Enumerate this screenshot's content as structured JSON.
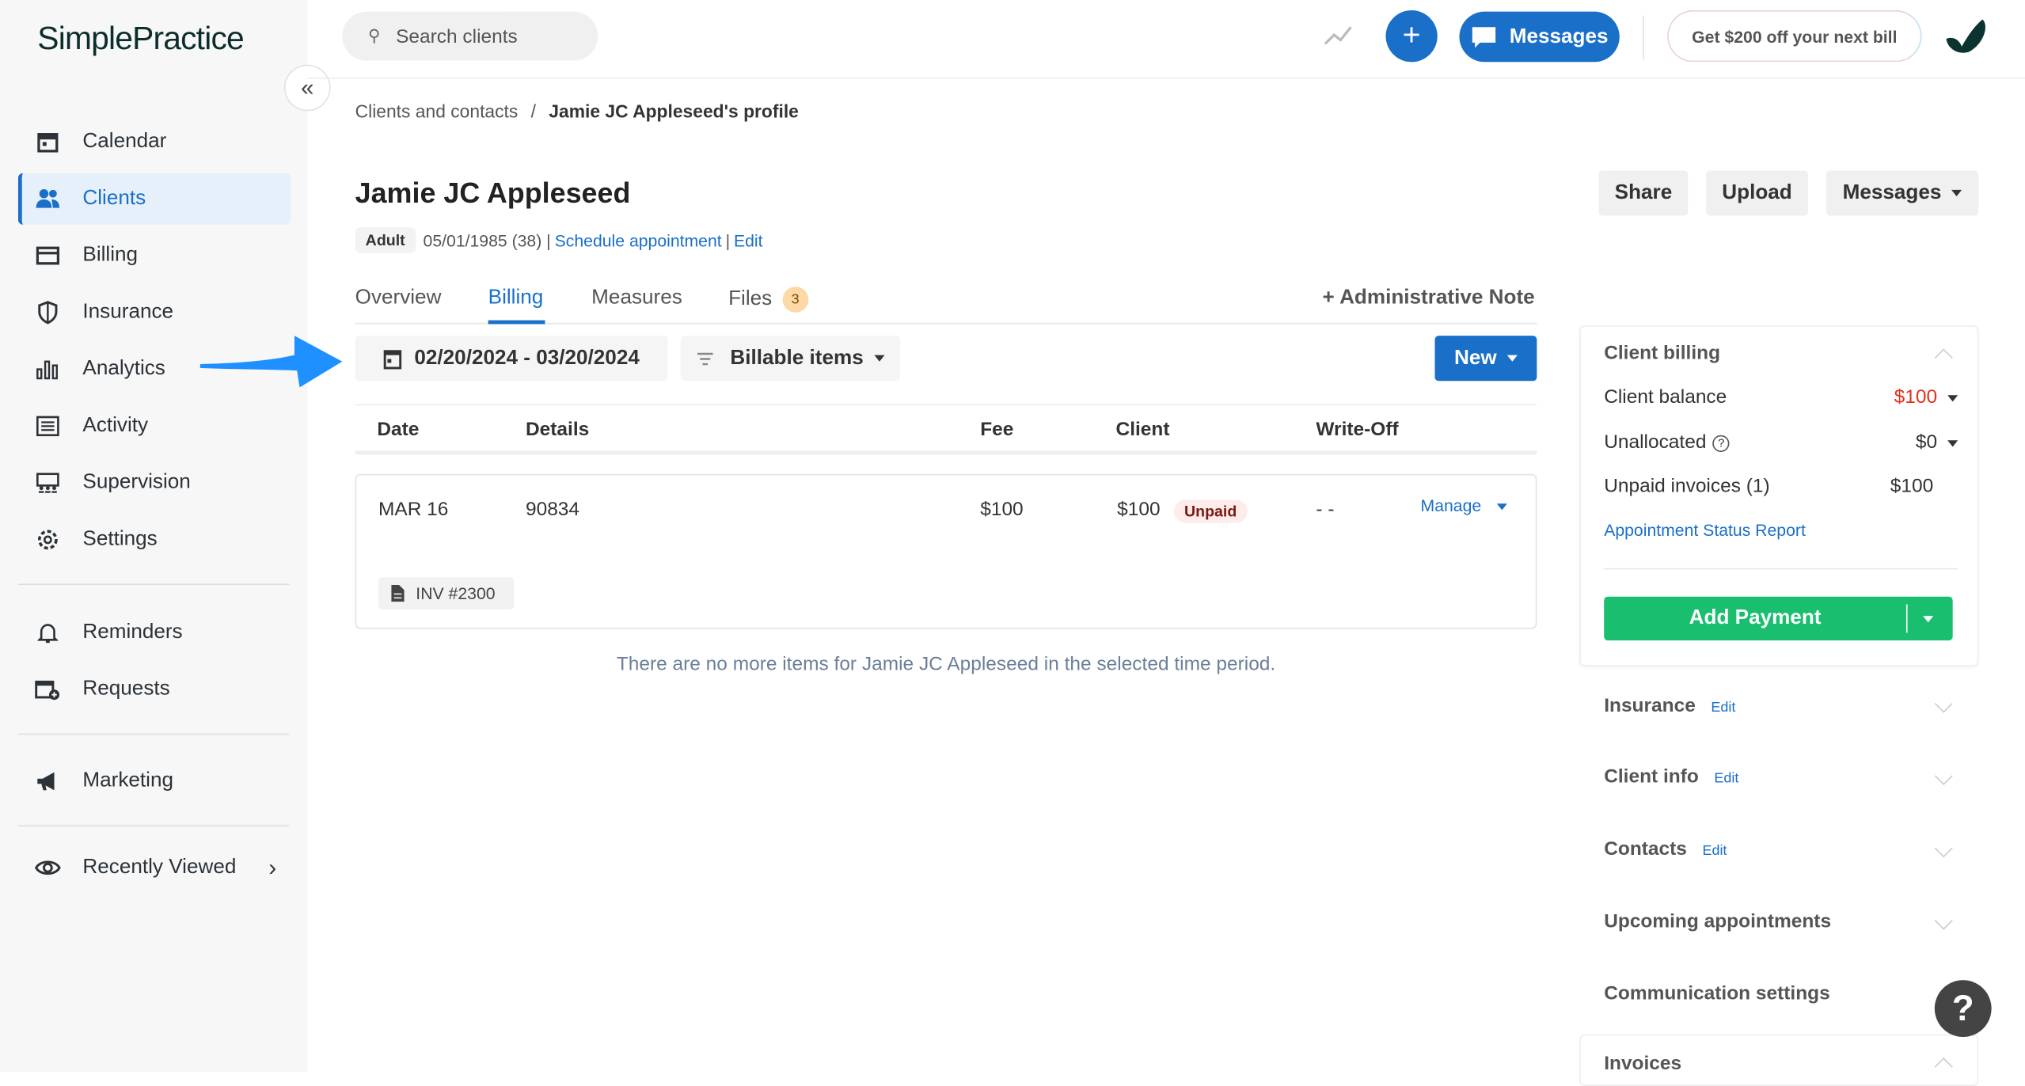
{
  "brand": {
    "logo": "SimplePractice"
  },
  "sidebar": {
    "items": [
      {
        "label": "Calendar",
        "icon": "calendar-icon"
      },
      {
        "label": "Clients",
        "icon": "clients-icon",
        "active": true
      },
      {
        "label": "Billing",
        "icon": "billing-icon"
      },
      {
        "label": "Insurance",
        "icon": "shield-icon"
      },
      {
        "label": "Analytics",
        "icon": "analytics-icon"
      },
      {
        "label": "Activity",
        "icon": "activity-icon"
      },
      {
        "label": "Supervision",
        "icon": "supervision-icon"
      },
      {
        "label": "Settings",
        "icon": "gear-icon"
      },
      {
        "label": "Reminders",
        "icon": "bell-icon"
      },
      {
        "label": "Requests",
        "icon": "calendar-plus-icon"
      },
      {
        "label": "Marketing",
        "icon": "megaphone-icon"
      },
      {
        "label": "Recently Viewed",
        "icon": "eye-icon"
      }
    ]
  },
  "topbar": {
    "search_placeholder": "Search clients",
    "messages_label": "Messages",
    "promo_label": "Get $200 off your next bill"
  },
  "breadcrumb": {
    "parent": "Clients and contacts",
    "separator": "/",
    "current": "Jamie JC Appleseed's profile"
  },
  "client": {
    "name": "Jamie JC Appleseed",
    "badge": "Adult",
    "dob": "05/01/1985 (38) |",
    "schedule_link": "Schedule appointment",
    "sep": "|",
    "edit_link": "Edit"
  },
  "actions": {
    "share": "Share",
    "upload": "Upload",
    "messages": "Messages"
  },
  "tabs": [
    {
      "label": "Overview"
    },
    {
      "label": "Billing",
      "active": true
    },
    {
      "label": "Measures"
    },
    {
      "label": "Files",
      "count": "3"
    }
  ],
  "admin_note": "+ Administrative Note",
  "filters": {
    "date_range": "02/20/2024 - 03/20/2024",
    "type": "Billable items",
    "new_label": "New"
  },
  "table": {
    "headers": [
      "Date",
      "Details",
      "Fee",
      "Client",
      "Write-Off"
    ],
    "rows": [
      {
        "date": "MAR 16",
        "details": "90834",
        "fee": "$100",
        "client": "$100",
        "status": "Unpaid",
        "writeoff": "- -",
        "manage": "Manage",
        "invoice": "INV #2300"
      }
    ],
    "empty_message": "There are no more items for Jamie JC Appleseed in the selected time period."
  },
  "client_billing": {
    "title": "Client billing",
    "balance_label": "Client balance",
    "balance_value": "$100",
    "unallocated_label": "Unallocated",
    "unallocated_value": "$0",
    "unpaid_label": "Unpaid invoices (1)",
    "unpaid_value": "$100",
    "report_link": "Appointment Status Report",
    "add_payment": "Add Payment"
  },
  "sections": [
    {
      "title": "Insurance",
      "edit": "Edit"
    },
    {
      "title": "Client info",
      "edit": "Edit"
    },
    {
      "title": "Contacts",
      "edit": "Edit"
    },
    {
      "title": "Upcoming appointments"
    },
    {
      "title": "Communication settings"
    },
    {
      "title": "Invoices"
    }
  ],
  "help": "?",
  "colors": {
    "primary": "#1a6fc9",
    "success": "#19bf6e",
    "danger": "#e0301e",
    "arrow": "#1e90ff"
  }
}
